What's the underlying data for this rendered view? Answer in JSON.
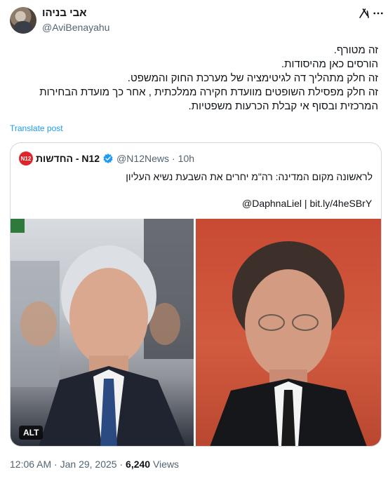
{
  "author": {
    "display_name": "אבי בניהו",
    "handle": "@AviBenayahu"
  },
  "icons": {
    "grok": "grok-icon",
    "more": "more-options-icon",
    "verified": "verified-badge-icon"
  },
  "tweet": {
    "lines": [
      "זה מטורף.",
      "הורסים כאן מהיסודות.",
      "זה חלק מתהליך דה לגיטימציה של מערכת החוק והמשפט.",
      "זה חלק מפסילת השופטים מוועדת חקירה ממלכתית , אחר כך מועדת הבחירות",
      "המרכזית ובסוף אי קבלת הכרעות משפטיות."
    ],
    "translate_label": "Translate post"
  },
  "quote": {
    "logo_text": "N12",
    "name": "החדשות - N12",
    "handle": "@N12News",
    "separator": "·",
    "time": "10h",
    "text": "לראשונה מקום המדינה: רה\"מ יחרים את השבעת נשיא העליון",
    "link_line": "@DaphnaLiel | bit.ly/4heSBrY",
    "alt_badge": "ALT"
  },
  "footer": {
    "time": "12:06 AM",
    "sep1": " · ",
    "date": "Jan 29, 2025",
    "sep2": " · ",
    "views_count": "6,240",
    "views_label": " Views"
  },
  "colors": {
    "accent": "#1d9bf0",
    "muted": "#536471",
    "border": "#cfd9de",
    "n12_red": "#e0242b"
  }
}
